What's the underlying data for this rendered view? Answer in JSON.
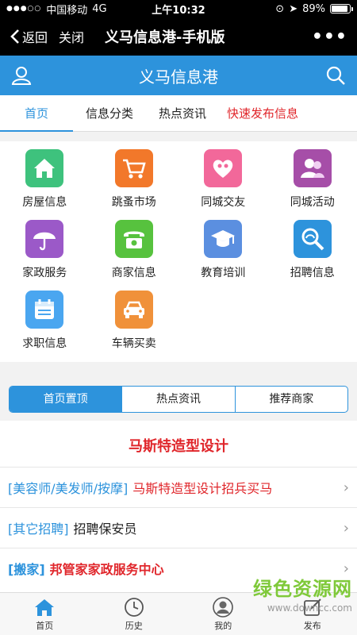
{
  "status": {
    "carrier": "中国移动",
    "network": "4G",
    "time": "上午10:32",
    "battery": "89%",
    "battery_level": 0.89
  },
  "wechat_bar": {
    "back_label": "返回",
    "close_label": "关闭",
    "title": "义马信息港-手机版",
    "more_icon": "more-icon"
  },
  "app_bar": {
    "title": "义马信息港",
    "user_icon": "user-icon",
    "search_icon": "search-icon",
    "color": "#2d93dc"
  },
  "tabs": [
    {
      "label": "首页"
    },
    {
      "label": "信息分类"
    },
    {
      "label": "热点资讯"
    },
    {
      "label": "快速发布信息"
    }
  ],
  "categories": [
    {
      "label": "房屋信息",
      "icon": "house-icon",
      "color": "#3ec27d"
    },
    {
      "label": "跳蚤市场",
      "icon": "cart-icon",
      "color": "#f2782a"
    },
    {
      "label": "同城交友",
      "icon": "heart-icon",
      "color": "#f2689a"
    },
    {
      "label": "同城活动",
      "icon": "people-icon",
      "color": "#a64ea8"
    },
    {
      "label": "家政服务",
      "icon": "umbrella-icon",
      "color": "#9b59c8"
    },
    {
      "label": "商家信息",
      "icon": "telephone-icon",
      "color": "#57c23e"
    },
    {
      "label": "教育培训",
      "icon": "graduation-cap-icon",
      "color": "#5b8fe0"
    },
    {
      "label": "招聘信息",
      "icon": "magnifier-icon",
      "color": "#2d93dc"
    },
    {
      "label": "求职信息",
      "icon": "calendar-icon",
      "color": "#4aa6f0"
    },
    {
      "label": "车辆买卖",
      "icon": "car-icon",
      "color": "#f0913a"
    }
  ],
  "segments": [
    {
      "label": "首页置顶"
    },
    {
      "label": "热点资讯"
    },
    {
      "label": "推荐商家"
    }
  ],
  "featured_title": "马斯特造型设计",
  "list": [
    {
      "category": "[美容师/美发师/按摩]",
      "title": "马斯特造型设计招兵买马",
      "title_color": "#e0262b"
    },
    {
      "category": "[其它招聘]",
      "title": "招聘保安员",
      "title_color": "#222222"
    },
    {
      "category": "[搬家]",
      "title": "邦管家家政服务中心",
      "title_color": "#e0262b"
    }
  ],
  "bottom_nav": [
    {
      "label": "首页",
      "icon": "home-icon"
    },
    {
      "label": "历史",
      "icon": "clock-icon"
    },
    {
      "label": "我的",
      "icon": "avatar-icon"
    },
    {
      "label": "发布",
      "icon": "edit-icon"
    }
  ],
  "watermark": {
    "brand": "绿色资源网",
    "domain": "www.downcc.com"
  }
}
